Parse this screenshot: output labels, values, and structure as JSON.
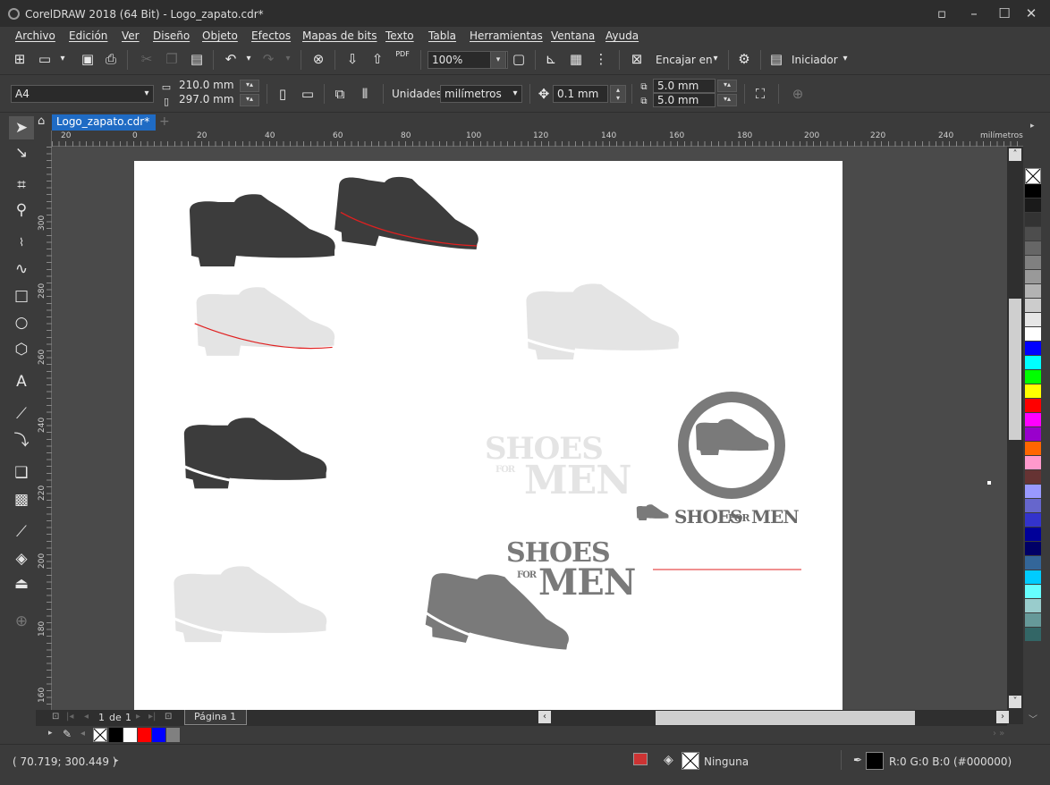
{
  "window": {
    "title": "CorelDRAW 2018 (64 Bit) - Logo_zapato.cdr*",
    "minimize": "–",
    "maximize": "☐",
    "close": "✕"
  },
  "menu": [
    "Archivo",
    "Edición",
    "Ver",
    "Diseño",
    "Objeto",
    "Efectos",
    "Mapas de bits",
    "Texto",
    "Tabla",
    "Herramientas",
    "Ventana",
    "Ayuda"
  ],
  "toolbar": {
    "zoom": "100%",
    "snap_label": "Encajar en",
    "launcher_label": "Iniciador",
    "pdf_label": "PDF"
  },
  "propbar": {
    "page_size": "A4",
    "width": "210.0 mm",
    "height": "297.0 mm",
    "units_label": "Unidades:",
    "units": "milímetros",
    "nudge": "0.1 mm",
    "dup_x": "5.0 mm",
    "dup_y": "5.0 mm"
  },
  "document_tab": "Logo_zapato.cdr*",
  "ruler": {
    "unit": "milímetros",
    "h_ticks": [
      "20",
      "0",
      "20",
      "40",
      "60",
      "80",
      "100",
      "120",
      "140",
      "160",
      "180",
      "200",
      "220",
      "240"
    ],
    "v_ticks": [
      "300",
      "280",
      "260",
      "240",
      "220",
      "200",
      "180",
      "160"
    ]
  },
  "artwork": {
    "logo_line1": "SHOES",
    "logo_for": "FOR",
    "logo_line2": "MEN",
    "inline_shoes": "SHOES",
    "inline_for": "FOR",
    "inline_men": "MEN"
  },
  "page_nav": {
    "current": "1",
    "of_label": "de",
    "total": "1",
    "page_tab": "Página 1"
  },
  "status": {
    "coords": "( 70.719; 300.449 )",
    "fill_label": "Ninguna",
    "outline_label": "R:0 G:0 B:0 (#000000)"
  },
  "palette_colors": [
    "#000000",
    "#1a1a1a",
    "#333333",
    "#4d4d4d",
    "#666666",
    "#808080",
    "#999999",
    "#b3b3b3",
    "#cccccc",
    "#e6e6e6",
    "#ffffff",
    "#0000ff",
    "#00ffff",
    "#00ff00",
    "#ffff00",
    "#ff0000",
    "#ff00ff",
    "#9900cc",
    "#ff6600",
    "#ff99cc",
    "#663333",
    "#9999ff",
    "#6666cc",
    "#3333cc",
    "#000099",
    "#000066",
    "#336699",
    "#00ccff",
    "#66ffff",
    "#99cccc",
    "#669999",
    "#336666"
  ],
  "doc_palette": [
    "#000000",
    "#ffffff",
    "#ff0000",
    "#0000ff",
    "#808080"
  ],
  "colors": {
    "accent": "#1f6bc4",
    "shoe_dark": "#3c3c3c",
    "shoe_mid": "#7a7a7a",
    "shoe_light": "#e4e4e4",
    "guide_red": "#e02020"
  }
}
